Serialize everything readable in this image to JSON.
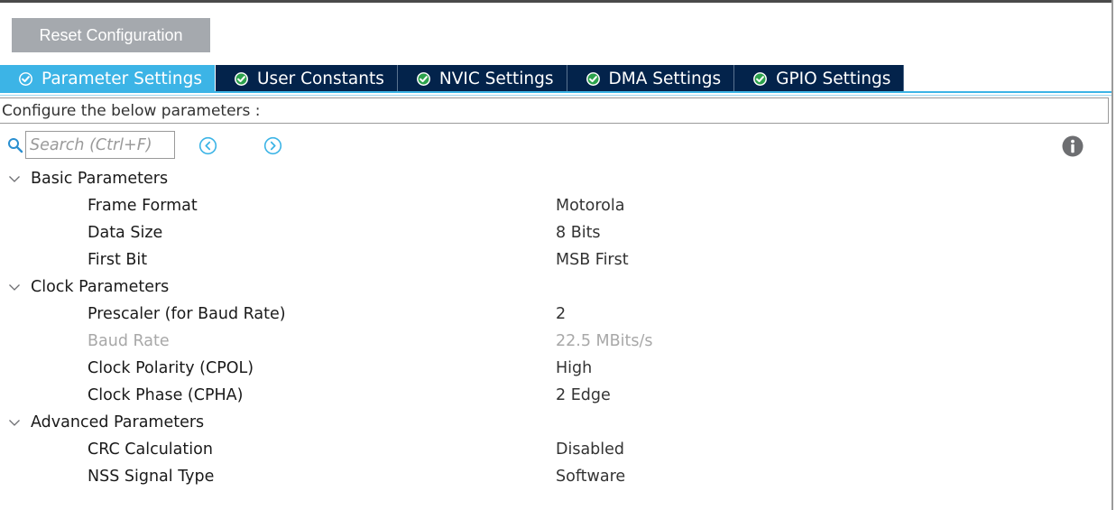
{
  "toolbar": {
    "reset_label": "Reset Configuration"
  },
  "tabs": [
    {
      "label": "Parameter Settings",
      "active": true,
      "icon": "check-circle-icon"
    },
    {
      "label": "User Constants",
      "active": false,
      "icon": "check-circle-icon"
    },
    {
      "label": "NVIC Settings",
      "active": false,
      "icon": "check-circle-icon"
    },
    {
      "label": "DMA Settings",
      "active": false,
      "icon": "check-circle-icon"
    },
    {
      "label": "GPIO Settings",
      "active": false,
      "icon": "check-circle-icon"
    }
  ],
  "configure_label": "Configure the below parameters :",
  "search": {
    "placeholder": "Search (Ctrl+F)",
    "value": ""
  },
  "icons": {
    "search": "search-icon",
    "prev": "chevron-left-circle-icon",
    "next": "chevron-right-circle-icon",
    "info": "info-icon",
    "expand": "chevron-down-icon"
  },
  "colors": {
    "tab_active": "#3cb4e6",
    "tab_inactive": "#03234b",
    "reset_button": "#a5a9ae",
    "disabled_text": "#a8a8a8"
  },
  "groups": [
    {
      "label": "Basic Parameters",
      "params": [
        {
          "name": "Frame Format",
          "value": "Motorola",
          "disabled": false
        },
        {
          "name": "Data Size",
          "value": "8 Bits",
          "disabled": false
        },
        {
          "name": "First Bit",
          "value": "MSB First",
          "disabled": false
        }
      ]
    },
    {
      "label": "Clock Parameters",
      "params": [
        {
          "name": "Prescaler (for Baud Rate)",
          "value": "2",
          "disabled": false
        },
        {
          "name": "Baud Rate",
          "value": "22.5 MBits/s",
          "disabled": true
        },
        {
          "name": "Clock Polarity (CPOL)",
          "value": "High",
          "disabled": false
        },
        {
          "name": "Clock Phase (CPHA)",
          "value": "2 Edge",
          "disabled": false
        }
      ]
    },
    {
      "label": "Advanced Parameters",
      "params": [
        {
          "name": "CRC Calculation",
          "value": "Disabled",
          "disabled": false
        },
        {
          "name": "NSS Signal Type",
          "value": "Software",
          "disabled": false
        }
      ]
    }
  ]
}
